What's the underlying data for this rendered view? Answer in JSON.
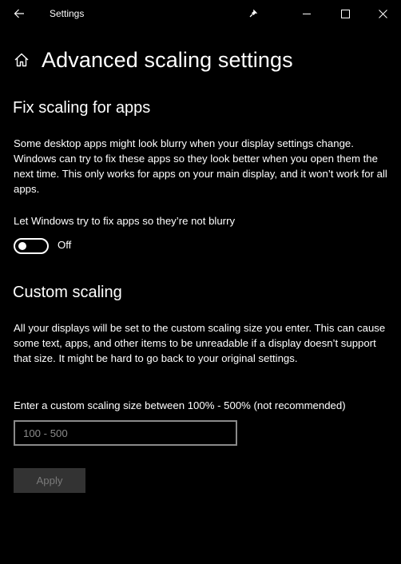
{
  "window": {
    "title": "Settings",
    "icons": {
      "back": "back-arrow-icon",
      "pin": "pin-icon",
      "minimize": "minimize-icon",
      "maximize": "maximize-icon",
      "close": "close-icon"
    }
  },
  "page": {
    "icon": "home-icon",
    "title": "Advanced scaling settings"
  },
  "fix_scaling": {
    "title": "Fix scaling for apps",
    "description": "Some desktop apps might look blurry when your display settings change. Windows can try to fix these apps so they look better when you open them the next time. This only works for apps on your main display, and it won’t work for all apps.",
    "toggle_label": "Let Windows try to fix apps so they’re not blurry",
    "toggle_state": "Off",
    "toggle_on": false
  },
  "custom_scaling": {
    "title": "Custom scaling",
    "description": "All your displays will be set to the custom scaling size you enter. This can cause some text, apps, and other items to be unreadable if a display doesn’t support that size. It might be hard to go back to your original settings.",
    "input_label": "Enter a custom scaling size between 100% - 500% (not recommended)",
    "input_placeholder": "100 - 500",
    "input_value": "",
    "apply_label": "Apply",
    "apply_enabled": false
  },
  "colors": {
    "background": "#000000",
    "text": "#ffffff",
    "disabled_button_bg": "#333333",
    "disabled_button_text": "#7a7a7a",
    "input_border": "#8a8a8a"
  }
}
